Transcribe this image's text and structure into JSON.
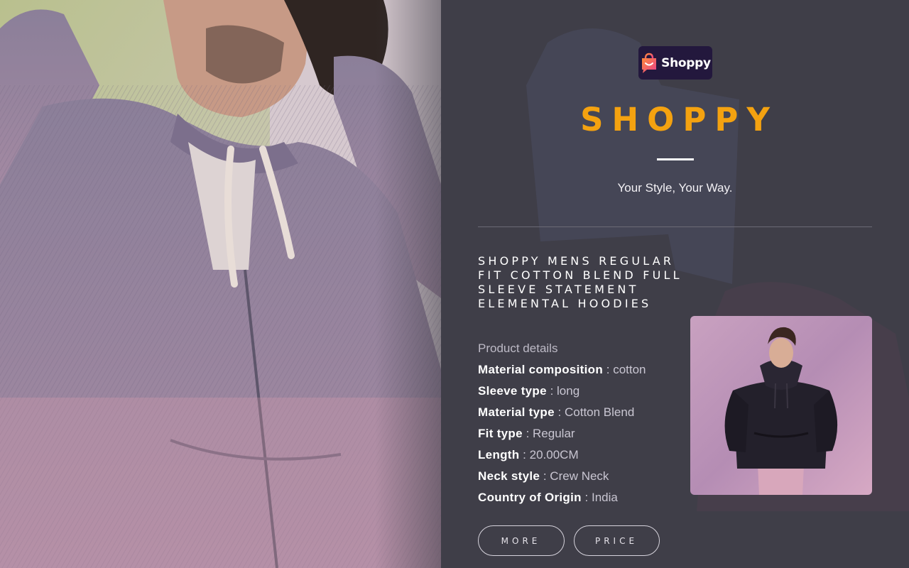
{
  "brand": {
    "logo_text": "Shoppy",
    "title": "SHOPPY",
    "tagline": "Your Style, Your Way."
  },
  "product": {
    "name": "SHOPPY MENS REGULAR FIT COTTON BLEND FULL SLEEVE STATEMENT ELEMENTAL HOODIES",
    "details_heading": "Product details",
    "details": [
      {
        "label": "Material composition",
        "value": "cotton"
      },
      {
        "label": "Sleeve type",
        "value": "long"
      },
      {
        "label": "Material type",
        "value": "Cotton Blend"
      },
      {
        "label": "Fit type",
        "value": "Regular"
      },
      {
        "label": "Length",
        "value": "20.00CM"
      },
      {
        "label": "Neck style",
        "value": "Crew Neck"
      },
      {
        "label": "Country of Origin",
        "value": "India"
      }
    ],
    "separator": " : "
  },
  "buttons": {
    "more_label": "MORE",
    "price_label": "PRICE"
  },
  "colors": {
    "accent": "#f4a210",
    "panel_bg": "#3f3e48",
    "logo_bg": "#23183d"
  },
  "icons": {
    "logo": "shopping-bag-chat-icon"
  }
}
